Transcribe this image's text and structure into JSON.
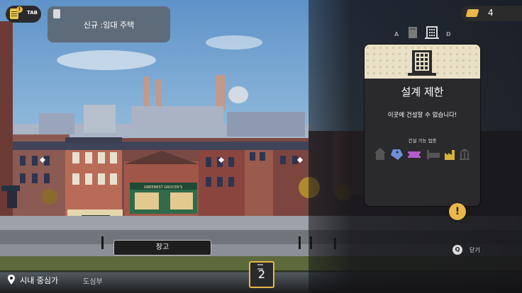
{
  "hud": {
    "quest_tab_label": "TAB",
    "notification": "신규 :임대 주택",
    "currency_value": "4",
    "tab_left_key": "A",
    "tab_right_key": "D"
  },
  "panel": {
    "title": "설계 제한",
    "message": "이곳에 건설할 수 없습니다!",
    "allowed_label": "건설 가능 업종",
    "allowed_icons": [
      "residential-icon",
      "shop-tag-icon",
      "ticket-icon",
      "bed-icon",
      "factory-icon",
      "bank-icon"
    ]
  },
  "scene": {
    "shop_sign": "GREENEST GROCER'S",
    "storage_label": "창고"
  },
  "controls": {
    "close_key": "Q",
    "close_label": "닫기"
  },
  "footer": {
    "district": "시내 중심가",
    "district_sub": "도심부",
    "level": "2"
  },
  "colors": {
    "accent": "#e9b84a",
    "panel_bg": "#2a2a2c",
    "panel_header": "#e9e1c7",
    "icon_blue": "#6f8fd8",
    "icon_purple": "#b25cc9",
    "icon_gold": "#d9b43a"
  }
}
